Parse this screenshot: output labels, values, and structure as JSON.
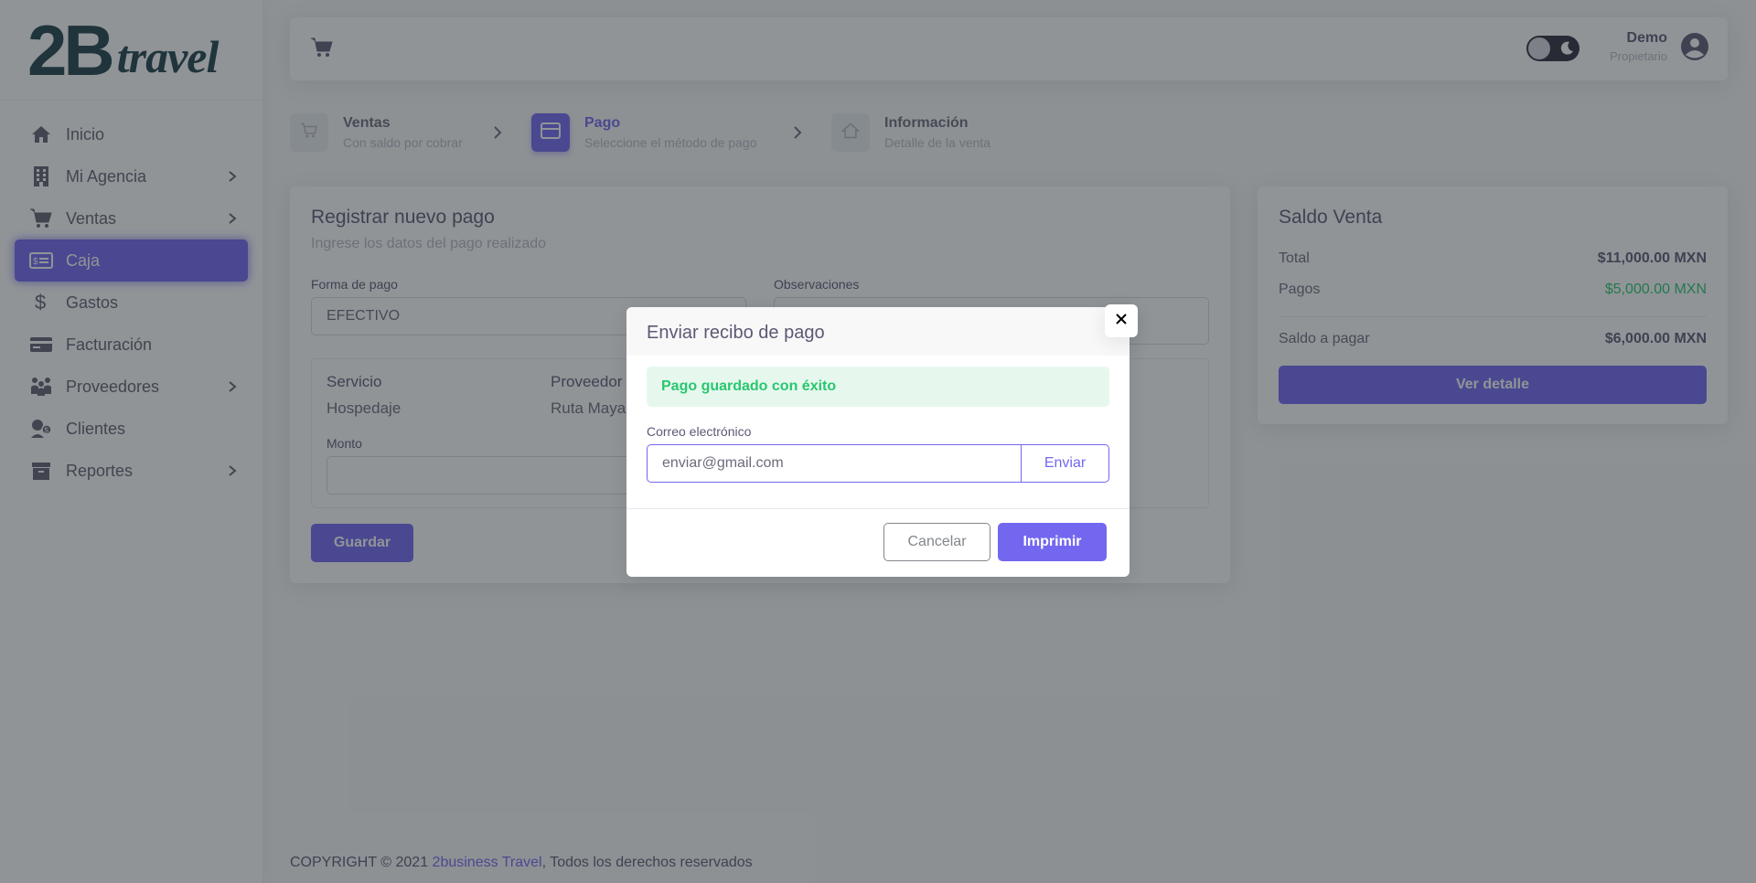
{
  "brand": {
    "logo_main": "2B",
    "logo_script": "travel"
  },
  "sidebar": {
    "items": [
      {
        "label": "Inicio",
        "icon": "home-icon",
        "has_submenu": false
      },
      {
        "label": "Mi Agencia",
        "icon": "building-icon",
        "has_submenu": true
      },
      {
        "label": "Ventas",
        "icon": "cart-icon",
        "has_submenu": true
      },
      {
        "label": "Caja",
        "icon": "cash-icon",
        "has_submenu": false,
        "active": true
      },
      {
        "label": "Gastos",
        "icon": "dollar-icon",
        "has_submenu": false
      },
      {
        "label": "Facturación",
        "icon": "credit-card-icon",
        "has_submenu": false
      },
      {
        "label": "Proveedores",
        "icon": "people-icon",
        "has_submenu": true
      },
      {
        "label": "Clientes",
        "icon": "clients-icon",
        "has_submenu": false
      },
      {
        "label": "Reportes",
        "icon": "archive-icon",
        "has_submenu": true
      }
    ]
  },
  "header": {
    "user_name": "Demo",
    "user_role": "Propietario"
  },
  "stepper": [
    {
      "title": "Ventas",
      "subtitle": "Con saldo por cobrar",
      "active": false
    },
    {
      "title": "Pago",
      "subtitle": "Seleccione el método de pago",
      "active": true
    },
    {
      "title": "Información",
      "subtitle": "Detalle de la venta",
      "active": false
    }
  ],
  "payment_form": {
    "title": "Registrar nuevo pago",
    "subtitle": "Ingrese los datos del pago realizado",
    "forma_pago_label": "Forma de pago",
    "forma_pago_value": "EFECTIVO",
    "observaciones_label": "Observaciones",
    "servicio_header": "Servicio",
    "servicio_value": "Hospedaje",
    "proveedor_header": "Proveedor",
    "proveedor_value": "Ruta Maya",
    "monto_label": "Monto",
    "save_button": "Guardar"
  },
  "balance": {
    "title": "Saldo Venta",
    "total_label": "Total",
    "total_value": "$11,000.00 MXN",
    "pagos_label": "Pagos",
    "pagos_value": "$5,000.00 MXN",
    "saldo_label": "Saldo a pagar",
    "saldo_value": "$6,000.00 MXN",
    "detail_button": "Ver detalle"
  },
  "footer": {
    "prefix": "COPYRIGHT © 2021 ",
    "link": "2business Travel",
    "suffix": ", Todos los derechos reservados"
  },
  "modal": {
    "title": "Enviar recibo de pago",
    "success_message": "Pago guardado con éxito",
    "email_label": "Correo electrónico",
    "email_placeholder": "enviar@gmail.com",
    "send_button": "Enviar",
    "cancel_button": "Cancelar",
    "print_button": "Imprimir"
  },
  "colors": {
    "primary": "#7367f0",
    "success": "#28c76f",
    "brand": "#1f3f49"
  }
}
